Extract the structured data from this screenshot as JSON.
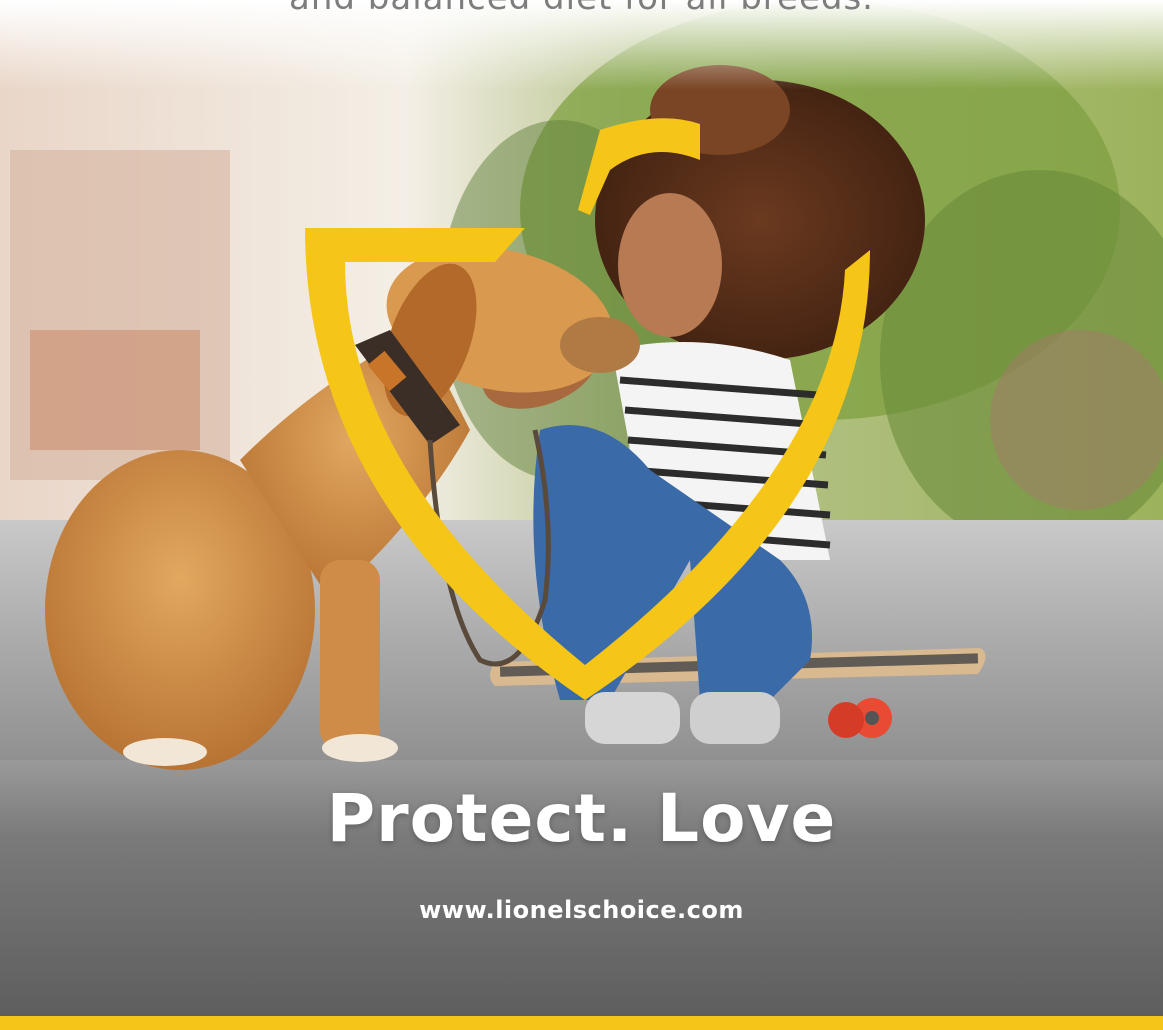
{
  "top_text": "and balanced diet for all breeds.",
  "tagline": "Protect. Love",
  "website": "www.lionelschoice.com",
  "colors": {
    "brand_yellow": "#f5c518",
    "grey_band": "#6e6e6e",
    "foliage_green": "#8aa84a"
  },
  "icons": [
    "shield-heart-logo"
  ]
}
